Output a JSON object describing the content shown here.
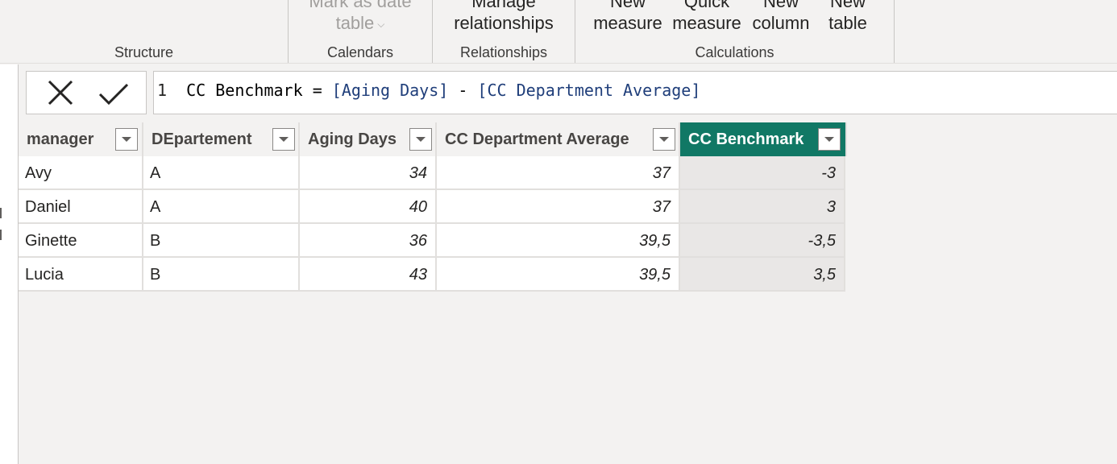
{
  "ribbon": {
    "groups": [
      {
        "label": "Structure",
        "buttons": []
      },
      {
        "label": "Calendars",
        "buttons": [
          {
            "line1": "Mark as date",
            "line2": "table",
            "disabled": true,
            "has_dropdown": true
          }
        ]
      },
      {
        "label": "Relationships",
        "buttons": [
          {
            "line1": "Manage",
            "line2": "relationships",
            "disabled": false
          }
        ]
      },
      {
        "label": "Calculations",
        "buttons": [
          {
            "line1": "New",
            "line2": "measure"
          },
          {
            "line1": "Quick",
            "line2": "measure"
          },
          {
            "line1": "New",
            "line2": "column"
          },
          {
            "line1": "New",
            "line2": "table"
          }
        ]
      }
    ]
  },
  "formula_bar": {
    "line_number": "1",
    "measure_name": "CC Benchmark",
    "operator_eq": "=",
    "ref1": "[Aging Days]",
    "operator_minus": "-",
    "ref2": "[CC Department Average]",
    "cancel_icon": "x-icon",
    "commit_icon": "check-icon"
  },
  "table": {
    "columns": [
      {
        "label": "manager",
        "type": "text"
      },
      {
        "label": "DEpartement",
        "type": "text"
      },
      {
        "label": "Aging Days",
        "type": "num"
      },
      {
        "label": "CC Department Average",
        "type": "num"
      },
      {
        "label": "CC Benchmark",
        "type": "num",
        "selected": true
      }
    ],
    "rows": [
      [
        "Avy",
        "A",
        "34",
        "37",
        "-3"
      ],
      [
        "Daniel",
        "A",
        "40",
        "37",
        "3"
      ],
      [
        "Ginette",
        "B",
        "36",
        "39,5",
        "-3,5"
      ],
      [
        "Lucia",
        "B",
        "43",
        "39,5",
        "3,5"
      ]
    ]
  },
  "colors": {
    "accent": "#117865",
    "background": "#f3f2f1",
    "formula_ref": "#1f3e7a"
  }
}
